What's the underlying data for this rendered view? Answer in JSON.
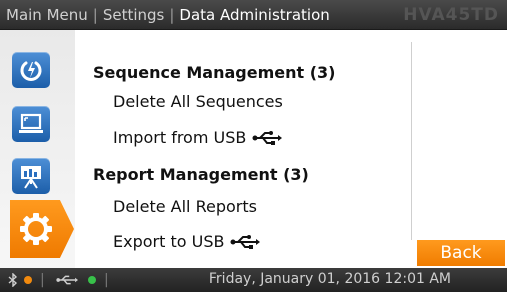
{
  "header": {
    "breadcrumb": [
      "Main Menu",
      "Settings",
      "Data Administration"
    ],
    "separator": "|",
    "model": "HVA45TD"
  },
  "sidebar": {
    "items": [
      {
        "icon": "power-icon",
        "active": false
      },
      {
        "icon": "laptop-icon",
        "active": false
      },
      {
        "icon": "presentation-icon",
        "active": false
      },
      {
        "icon": "gear-icon",
        "active": true
      }
    ]
  },
  "main": {
    "sections": [
      {
        "title": "Sequence Management (3)",
        "items": [
          {
            "label": "Delete All Sequences",
            "icon": ""
          },
          {
            "label": "Import from USB",
            "icon": "usb-icon"
          }
        ]
      },
      {
        "title": "Report Management (3)",
        "items": [
          {
            "label": "Delete All Reports",
            "icon": ""
          },
          {
            "label": "Export to USB",
            "icon": "usb-icon"
          }
        ]
      }
    ],
    "back_label": "Back"
  },
  "status": {
    "bluetooth_icon": "bluetooth-icon",
    "usb_icon": "usb-icon",
    "separator": "|",
    "datetime": "Friday, January 01, 2016 12:01 AM"
  },
  "colors": {
    "accent": "#f28a0e",
    "nav_blue": "#2a6fbf",
    "bluetooth_dot": "#f28a0e",
    "usb_dot": "#38c14a"
  }
}
